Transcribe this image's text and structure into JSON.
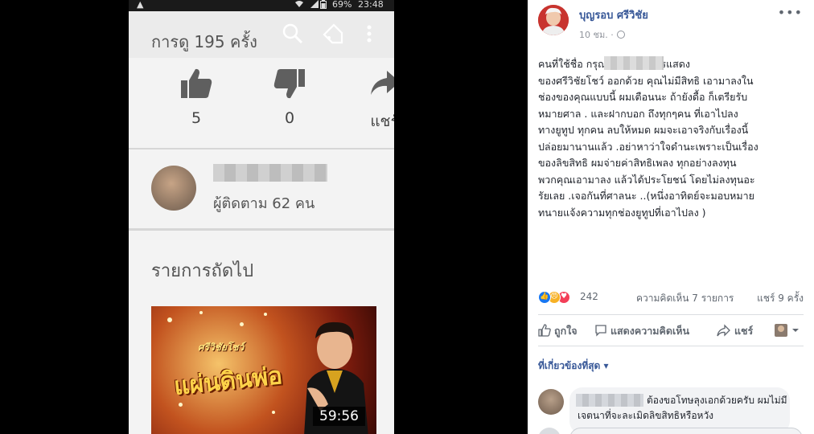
{
  "phone": {
    "status": {
      "warning": "▲",
      "battery_pct": "69%",
      "clock": "23:48"
    },
    "views_text": "การดู 195 ครั้ง",
    "actions": {
      "likes": "5",
      "dislikes": "0",
      "share_label": "แชร์"
    },
    "channel": {
      "subscribers": "ผู้ติดตาม 62 คน"
    },
    "next_title": "รายการถัดไป",
    "thumbnail": {
      "small_logo": "ศรีวิชัยโชว์",
      "title_text": "แผ่นดินพ่อ",
      "duration": "59:56"
    }
  },
  "fb": {
    "author": "บุญรอบ ศรีวิชัย",
    "time": "10 ชม. ·",
    "more": "•••",
    "body": "คนที่ใช้ชื่อ                       กรุณาลบบรรที่การแสดง\nของศรีวิชัยโชว์ ออกด้วย คุณไม่มีสิทธิ เอามาลงใน\nช่องของคุณแบบนี้ ผมเตือนนะ ถ้ายังดื้อ ก็เตรียรับ\nหมายศาล . และฝากบอก ถึงทุกๆคน ที่เอาไปลง\nทางยูทูป ทุกคน ลบให้หมด ผมจะเอาจริงกับเรื่องนี้\nปล่อยมานานแล้ว .อย่าหาว่าใจดำนะเพราะเป็นเรื่อง\nของลิขสิทธิ ผมจ่ายค่าสิทธิเพลง ทุกอย่างลงทุน\nพวกคุณเอามาลง แล้วได้ประโยชน์ โดยไม่ลงทุนอะ\nรัยเลย .เจอกันที่ศาลนะ ..(หนึ่งอาทิตย์จะมอบหมาย\nทนายแจ้งความทุกช่องยูทูปที่เอาไปลง )",
    "reactions": {
      "count": "242",
      "comments": "ความคิดเห็น 7 รายการ",
      "shares": "แชร์ 9 ครั้ง"
    },
    "actions": {
      "like": "ถูกใจ",
      "comment": "แสดงความคิดเห็น",
      "share": "แชร์"
    },
    "relevant": "ที่เกี่ยวข้องที่สุด ▾",
    "comment_text": "ต้องขอโทษลุงเอกด้วยครับ ผมไม่มีเจตนาที่จะละเมิดลิขสิทธิหรือหวัง"
  },
  "colors": {
    "fb_link": "#385898",
    "fb_text": "#1d2129",
    "fb_muted": "#606770"
  }
}
